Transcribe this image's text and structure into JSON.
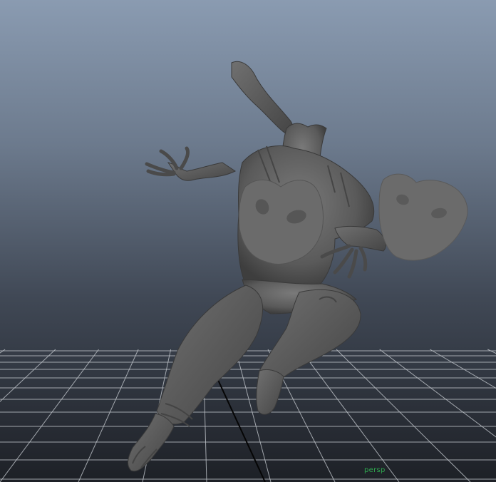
{
  "viewport": {
    "camera_name": "persp",
    "label_color": "#2fa84f",
    "grid_color": "#b9bdc3",
    "grid_axis_color": "#050505",
    "model_color": "#5c5c5c",
    "mask_color": "#6b6b6b"
  },
  "scene": {
    "model_icon": "creature-model-icon",
    "mask_icon": "mask-icon"
  }
}
